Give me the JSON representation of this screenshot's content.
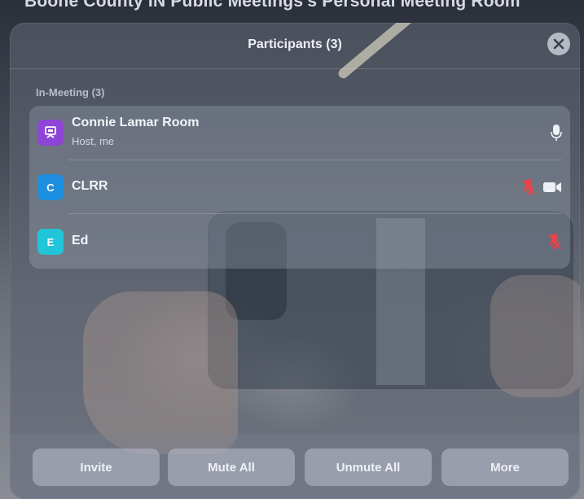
{
  "background_title": "Boone County IN Public Meetings's Personal Meeting Room",
  "header": {
    "title": "Participants (3)"
  },
  "section": {
    "label": "In-Meeting (3)"
  },
  "participants": [
    {
      "name": "Connie Lamar Room",
      "role": "Host, me",
      "avatar_letter": "",
      "avatar_icon": "room-icon",
      "avatar_color": "#8e44d6",
      "audio": "unmuted",
      "video": "off"
    },
    {
      "name": "CLRR",
      "role": "",
      "avatar_letter": "C",
      "avatar_color": "#1e8fe0",
      "audio": "muted",
      "video": "on"
    },
    {
      "name": "Ed",
      "role": "",
      "avatar_letter": "E",
      "avatar_color": "#22c4d8",
      "audio": "muted",
      "video": "off"
    }
  ],
  "footer": {
    "invite_label": "Invite",
    "mute_all_label": "Mute All",
    "unmute_all_label": "Unmute All",
    "more_label": "More"
  },
  "colors": {
    "muted_red": "#e8434a",
    "icon_white": "#eef0f5"
  }
}
